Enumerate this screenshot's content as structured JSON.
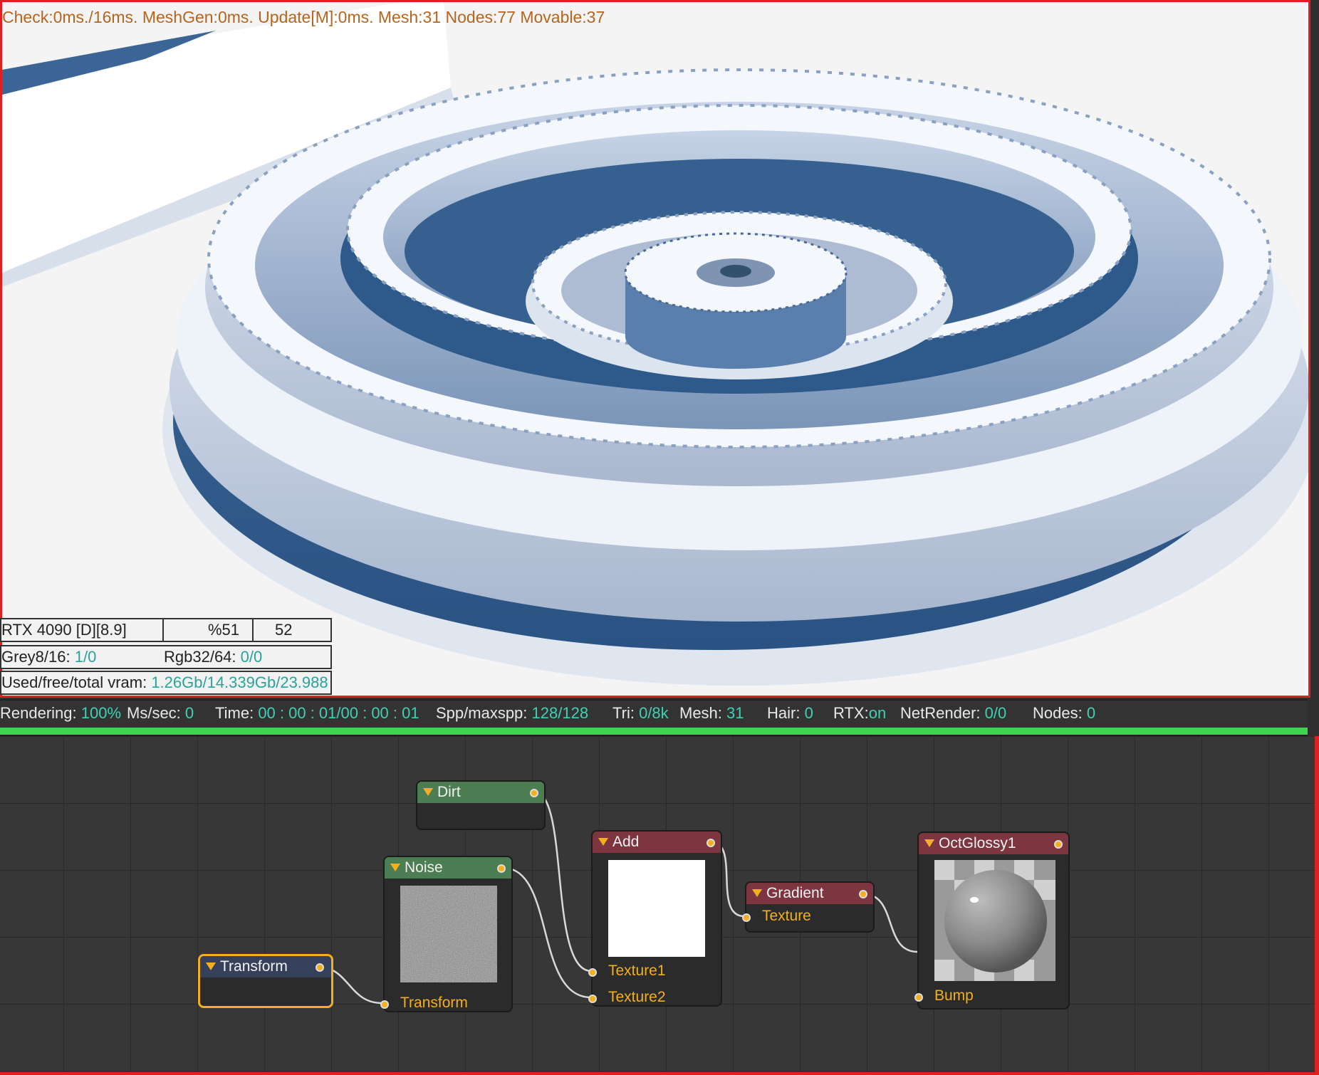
{
  "viewport": {
    "perf_text": "Check:0ms./16ms. MeshGen:0ms. Update[M]:0ms. Mesh:31 Nodes:77 Movable:37"
  },
  "device_info": {
    "gpu_name": "RTX 4090 [D][8.9]",
    "usage": "%51",
    "temperature": "52",
    "grey_label": "Grey8/16:",
    "grey_value": "1/0",
    "rgb_label": "Rgb32/64:",
    "rgb_value": "0/0",
    "vram_label": "Used/free/total vram:",
    "vram_value": "1.26Gb/14.339Gb/23.988"
  },
  "status": {
    "rendering_label": "Rendering:",
    "rendering_value": "100%",
    "ms_label": "Ms/sec:",
    "ms_value": "0",
    "time_label": "Time:",
    "time_value": "00 : 00 : 01/00 : 00 : 01",
    "spp_label": "Spp/maxspp:",
    "spp_value": "128/128",
    "tri_label": "Tri:",
    "tri_value": "0/8k",
    "mesh_label": "Mesh:",
    "mesh_value": "31",
    "hair_label": "Hair:",
    "hair_value": "0",
    "rtx_label": "RTX:",
    "rtx_value": "on",
    "netrender_label": "NetRender:",
    "netrender_value": "0/0",
    "nodes_label": "Nodes:",
    "nodes_value": "0",
    "progress": 1.0
  },
  "nodes": {
    "dirt": {
      "title": "Dirt"
    },
    "noise": {
      "title": "Noise",
      "input": "Transform"
    },
    "transform": {
      "title": "Transform"
    },
    "add": {
      "title": "Add",
      "input1": "Texture1",
      "input2": "Texture2"
    },
    "gradient": {
      "title": "Gradient",
      "input": "Texture"
    },
    "glossy": {
      "title": "OctGlossy1",
      "input": "Bump"
    }
  },
  "colors": {
    "accent": "#f2b01e",
    "texture_node_header": "#4d7d52",
    "math_node_header": "#7d3640",
    "transform_node_header": "#36405a",
    "status_value": "#3ed1b4",
    "progress": "#3fd64f"
  }
}
